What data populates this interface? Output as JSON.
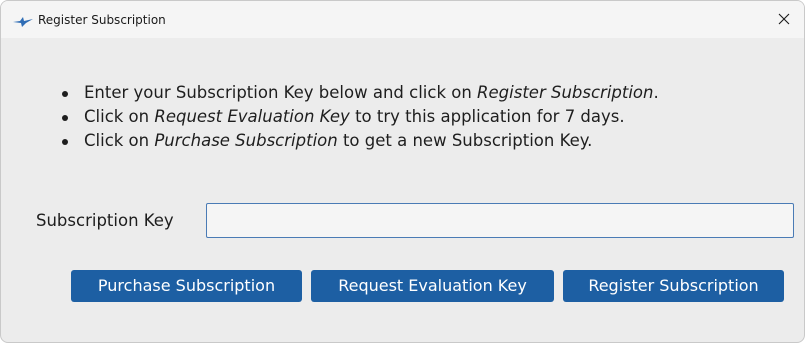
{
  "window": {
    "title": "Register Subscription",
    "close_glyph": "✕",
    "icons": {
      "app": "app-bird-icon",
      "close": "close-icon"
    },
    "colors": {
      "accent": "#1d5fa3",
      "input_border": "#4a7bb5",
      "background": "#ececec"
    }
  },
  "instructions": [
    {
      "before": "Enter your Subscription Key below and click on ",
      "emphasis": "Register Subscription",
      "after": "."
    },
    {
      "before": "Click on ",
      "emphasis": "Request Evaluation Key",
      "after": " to try this application for 7 days."
    },
    {
      "before": "Click on ",
      "emphasis": "Purchase Subscription",
      "after": " to get a new Subscription Key."
    }
  ],
  "form": {
    "key_label": "Subscription Key",
    "key_value": "",
    "key_placeholder": ""
  },
  "buttons": {
    "purchase": "Purchase Subscription",
    "evaluation": "Request Evaluation Key",
    "register": "Register Subscription"
  }
}
